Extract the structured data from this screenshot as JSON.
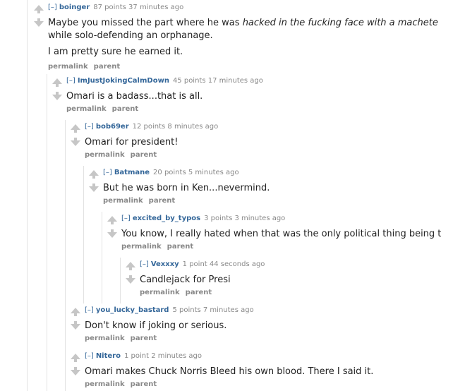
{
  "comments": [
    {
      "expand": "[–]",
      "author": "boinger",
      "score": "87 points 37 minutes ago",
      "paragraphs": [
        [
          "Maybe you missed the part where he was ",
          "hacked in the fucking face with a machete",
          ""
        ],
        [
          "while solo-defending an orphanage."
        ],
        [
          "I am pretty sure he earned it."
        ]
      ],
      "permalink": "permalink",
      "parent": "parent"
    },
    {
      "expand": "[–]",
      "author": "ImJustJokingCalmDown",
      "score": "45 points 17 minutes ago",
      "text": "Omari is a badass...that is all.",
      "permalink": "permalink",
      "parent": "parent"
    },
    {
      "expand": "[–]",
      "author": "bob69er",
      "score": "12 points 8 minutes ago",
      "text": "Omari for president!",
      "permalink": "permalink",
      "parent": "parent"
    },
    {
      "expand": "[–]",
      "author": "Batmane",
      "score": "20 points 5 minutes ago",
      "text": "But he was born in Ken...nevermind.",
      "permalink": "permalink",
      "parent": "parent"
    },
    {
      "expand": "[–]",
      "author": "excited_by_typos",
      "score": "3 points 3 minutes ago",
      "text": "You know, I really hated when that was the only political thing being t",
      "permalink": "permalink",
      "parent": "parent"
    },
    {
      "expand": "[–]",
      "author": "Vexxxy",
      "score": "1 point 44 seconds ago",
      "text": "Candlejack for Presi",
      "permalink": "permalink",
      "parent": "parent"
    },
    {
      "expand": "[–]",
      "author": "you_lucky_bastard",
      "score": "5 points 7 minutes ago",
      "text": "Don't know if joking or serious.",
      "permalink": "permalink",
      "parent": "parent"
    },
    {
      "expand": "[–]",
      "author": "Nitero",
      "score": "1 point 2 minutes ago",
      "text": "Omari makes Chuck Norris Bleed his own blood. There I said it.",
      "permalink": "permalink",
      "parent": "parent"
    }
  ],
  "colors": {
    "author": "#336699",
    "meta": "#888888",
    "arrow": "#c6c6c6",
    "guide": "#e2e2e2"
  }
}
